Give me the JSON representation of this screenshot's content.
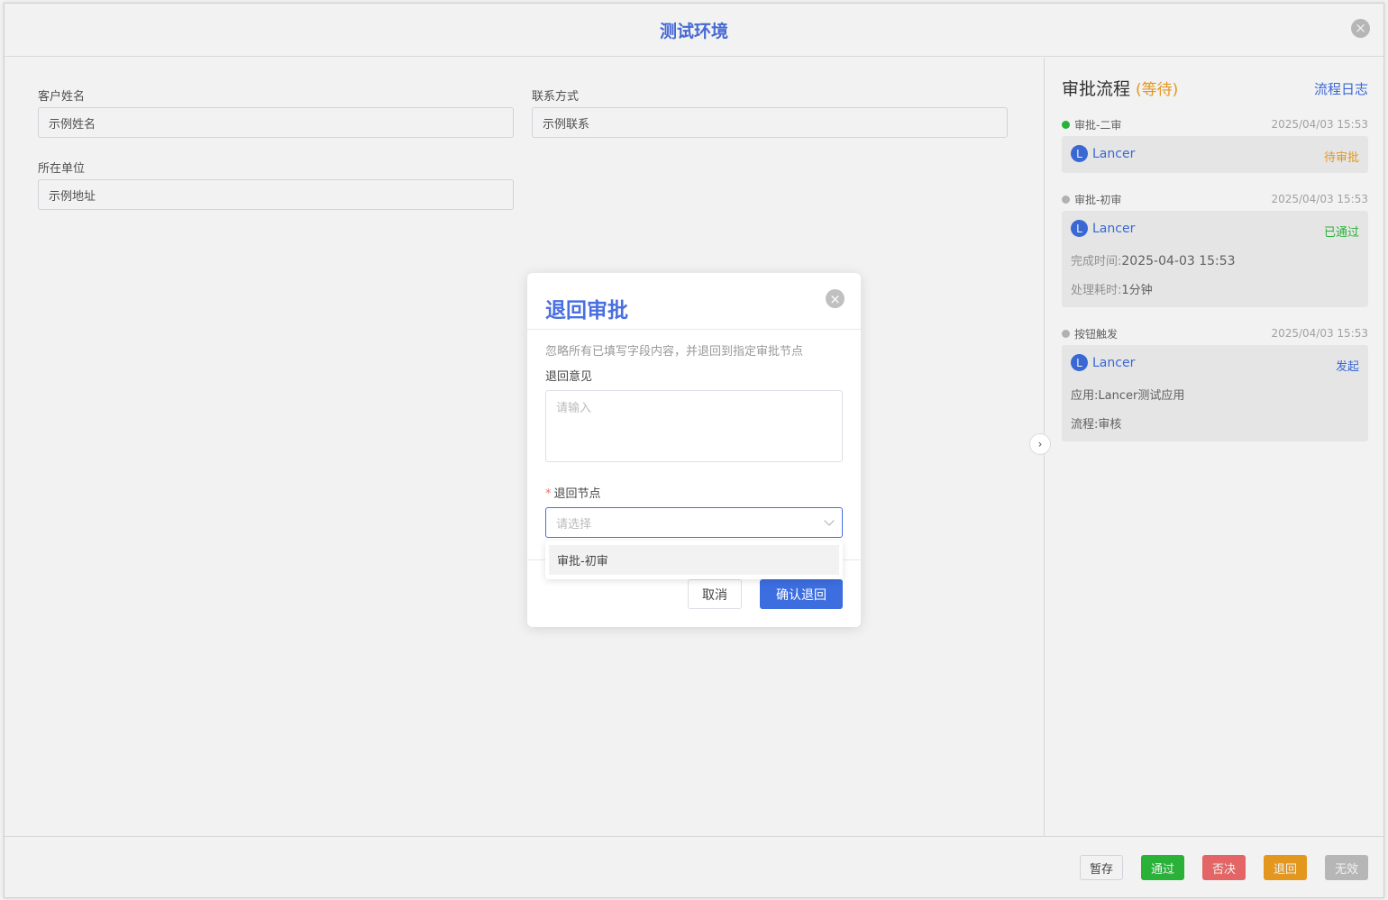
{
  "window": {
    "title": "测试环境",
    "close_icon": "close-circle-icon"
  },
  "form": {
    "customer_name": {
      "label": "客户姓名",
      "value": "示例姓名"
    },
    "contact": {
      "label": "联系方式",
      "value": "示例联系"
    },
    "company": {
      "label": "所在单位",
      "value": "示例地址"
    }
  },
  "approval_panel": {
    "title": "审批流程",
    "status": "(等待)",
    "log_link": "流程日志",
    "nodes": [
      {
        "name": "审批-二审",
        "time": "2025/04/03 15:53",
        "dot_color": "#2cbb3c",
        "user_initial": "L",
        "user": "Lancer",
        "state": "待审批",
        "state_color": "#f0a020"
      },
      {
        "name": "审批-初审",
        "time": "2025/04/03 15:53",
        "dot_color": "#bbbbbb",
        "user_initial": "L",
        "user": "Lancer",
        "state": "已通过",
        "state_color": "#2cbb3c",
        "details": [
          {
            "key": "完成时间:",
            "value": "2025-04-03 15:53"
          },
          {
            "key": "处理耗时:",
            "value": "1分钟"
          }
        ]
      },
      {
        "name": "按钮触发",
        "time": "2025/04/03 15:53",
        "dot_color": "#bbbbbb",
        "user_initial": "L",
        "user": "Lancer",
        "state": "发起",
        "state_color": "#3d6ee0",
        "details": [
          {
            "key": "应用:",
            "value": "Lancer测试应用"
          },
          {
            "key": "流程:",
            "value": "审核"
          }
        ]
      }
    ]
  },
  "footer_buttons": {
    "save_draft": "暂存",
    "approve": "通过",
    "reject": "否决",
    "return": "退回",
    "invalid": "无效"
  },
  "colors": {
    "accent": "#4a6fe0",
    "approve": "#2cbb3c",
    "reject": "#f06b6b",
    "return": "#f0a020",
    "invalid": "#c0c0c0"
  },
  "modal": {
    "title": "退回审批",
    "hint": "忽略所有已填写字段内容，并退回到指定审批节点",
    "opinion_label": "退回意见",
    "opinion_placeholder": "请输入",
    "node_label": "退回节点",
    "required_mark": "*",
    "node_placeholder": "请选择",
    "dropdown_options": [
      "审批-初审"
    ],
    "cancel": "取消",
    "confirm": "确认退回"
  }
}
